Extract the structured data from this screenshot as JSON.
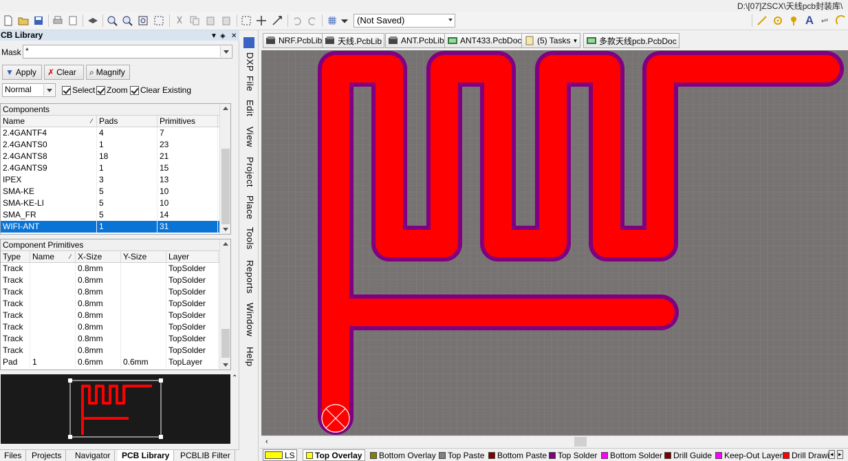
{
  "window": {
    "path_title": "D:\\[07]ZSCX\\天线pcb封装库\\"
  },
  "toolbar": {
    "saved_state": "(Not Saved)"
  },
  "panel": {
    "title": "CB Library",
    "mask_label": "Mask",
    "mask_value": "*",
    "apply_label": "Apply",
    "clear_label": "Clear",
    "magnify_label": "Magnify",
    "mode_value": "Normal",
    "select_label": "Select",
    "zoom_label": "Zoom",
    "clear_existing_label": "Clear Existing"
  },
  "components": {
    "title": "Components",
    "columns": [
      "Name",
      "Pads",
      "Primitives"
    ],
    "rows": [
      [
        "2.4GANTF4",
        "4",
        "7"
      ],
      [
        "2.4GANTS0",
        "1",
        "23"
      ],
      [
        "2.4GANTS8",
        "18",
        "21"
      ],
      [
        "2.4GANTS9",
        "1",
        "15"
      ],
      [
        "IPEX",
        "3",
        "13"
      ],
      [
        "SMA-KE",
        "5",
        "10"
      ],
      [
        "SMA-KE-LI",
        "5",
        "10"
      ],
      [
        "SMA_FR",
        "5",
        "14"
      ],
      [
        "WIFI-ANT",
        "1",
        "31"
      ]
    ],
    "selected_index": 8
  },
  "primitives": {
    "title": "Component Primitives",
    "columns": [
      "Type",
      "Name",
      "X-Size",
      "Y-Size",
      "Layer"
    ],
    "rows": [
      [
        "Track",
        "",
        "0.8mm",
        "",
        "TopSolder"
      ],
      [
        "Track",
        "",
        "0.8mm",
        "",
        "TopSolder"
      ],
      [
        "Track",
        "",
        "0.8mm",
        "",
        "TopSolder"
      ],
      [
        "Track",
        "",
        "0.8mm",
        "",
        "TopSolder"
      ],
      [
        "Track",
        "",
        "0.8mm",
        "",
        "TopSolder"
      ],
      [
        "Track",
        "",
        "0.8mm",
        "",
        "TopSolder"
      ],
      [
        "Track",
        "",
        "0.8mm",
        "",
        "TopSolder"
      ],
      [
        "Track",
        "",
        "0.8mm",
        "",
        "TopSolder"
      ],
      [
        "Pad",
        "1",
        "0.6mm",
        "0.6mm",
        "TopLayer"
      ]
    ]
  },
  "bottom_tabs": [
    "Files",
    "Projects",
    "Navigator",
    "PCB Library",
    "PCBLIB Filter"
  ],
  "active_bottom_tab": "PCB Library",
  "menu": [
    "DXP",
    "File",
    "Edit",
    "View",
    "Project",
    "Place",
    "Tools",
    "Reports",
    "Window",
    "Help"
  ],
  "doc_tabs": [
    "NRF.PcbLib",
    "天线.PcbLib",
    "ANT.PcbLib",
    "ANT433.PcbDoc",
    "(5) Tasks",
    "多款天线pcb.PcbDoc"
  ],
  "layers": {
    "ls_label": "LS",
    "items": [
      {
        "name": "Top Overlay",
        "color": "#ffff00",
        "active": true
      },
      {
        "name": "Bottom Overlay",
        "color": "#808000"
      },
      {
        "name": "Top Paste",
        "color": "#808080"
      },
      {
        "name": "Bottom Paste",
        "color": "#800000"
      },
      {
        "name": "Top Solder",
        "color": "#800080"
      },
      {
        "name": "Bottom Solder",
        "color": "#ff00ff"
      },
      {
        "name": "Drill Guide",
        "color": "#800000"
      },
      {
        "name": "Keep-Out Layer",
        "color": "#ff00ff"
      },
      {
        "name": "Drill Drawin",
        "color": "#ff0000"
      }
    ]
  },
  "colors": {
    "track": "#ff0000",
    "solder": "#800080",
    "canvas": "#777373",
    "grid": "#8c8888"
  }
}
